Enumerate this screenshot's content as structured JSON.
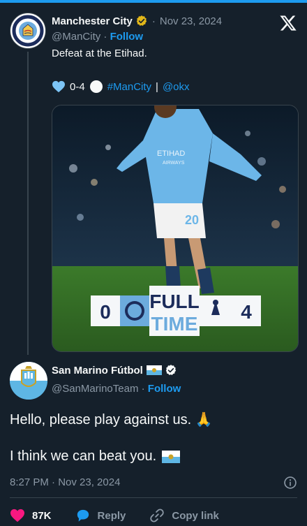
{
  "parent_tweet": {
    "name": "Manchester City",
    "time_sep": "·",
    "date": "Nov 23, 2024",
    "handle": "@ManCity",
    "handle_sep": "·",
    "follow_label": "Follow",
    "text_line1": "Defeat at the Etihad.",
    "score_text": "0-4",
    "hashtag": "#ManCity",
    "pipe": "|",
    "mention": "@okx",
    "badge_text": "MANCHESTER CITY",
    "badge_city": "CITY"
  },
  "media": {
    "home_score": "0",
    "away_score": "4",
    "full_label": "FULL",
    "time_label": "TIME",
    "shirt_number": "20",
    "sponsor_line1": "ETIHAD",
    "sponsor_line2": "AIRWAYS"
  },
  "reply_tweet": {
    "name": "San Marino Fútbol",
    "handle": "@SanMarinoTeam",
    "handle_sep": "·",
    "follow_label": "Follow",
    "text_line1": "Hello, please play against us.",
    "text_line1_emoji": "🙏",
    "text_line2": "I think we can beat you.",
    "timestamp": "8:27 PM · Nov 23, 2024"
  },
  "actions": {
    "likes": "87K",
    "reply_label": "Reply",
    "copy_label": "Copy link"
  },
  "icons": {
    "x_logo": "x-logo-icon",
    "verified": "verified-badge-icon",
    "info": "info-icon",
    "heart": "heart-icon",
    "reply": "reply-bubble-icon",
    "link": "link-icon"
  },
  "colors": {
    "background": "#15202b",
    "accent": "#1d9bf0",
    "like": "#f91880",
    "city_blue": "#6cabdd",
    "gold_verified": "#e2b719"
  }
}
